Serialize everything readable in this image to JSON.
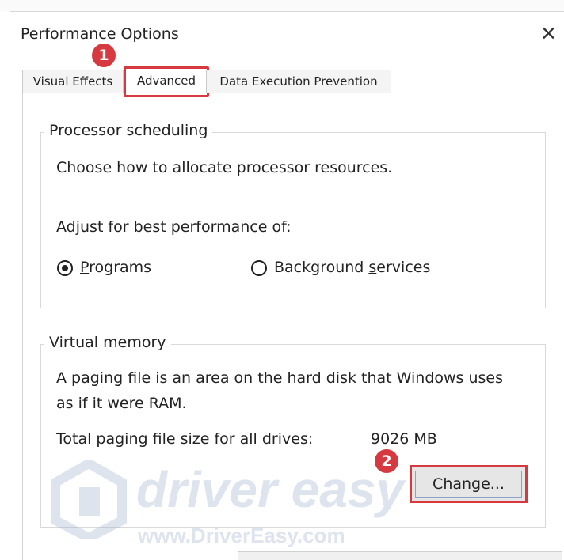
{
  "window": {
    "title": "Performance Options",
    "close_glyph": "✕"
  },
  "tabs": [
    {
      "label": "Visual Effects"
    },
    {
      "label": "Advanced",
      "selected": true
    },
    {
      "label": "Data Execution Prevention"
    }
  ],
  "processor": {
    "legend": "Processor scheduling",
    "description": "Choose how to allocate processor resources.",
    "adjust_label": "Adjust for best performance of:",
    "option_programs": {
      "mnemonic": "P",
      "rest": "rograms",
      "checked": true
    },
    "option_background": {
      "prefix": "Background ",
      "mnemonic": "s",
      "rest": "ervices",
      "checked": false
    }
  },
  "virtual_memory": {
    "legend": "Virtual memory",
    "description_line1": "A paging file is an area on the hard disk that Windows uses",
    "description_line2": "as if it were RAM.",
    "total_label": "Total paging file size for all drives:",
    "total_value": "9026 MB",
    "change_button": {
      "mnemonic": "C",
      "rest": "hange..."
    }
  },
  "annotations": {
    "step1": "1",
    "step2": "2",
    "accent": "#d63a40"
  },
  "watermark": {
    "brand": "driver easy",
    "url": "www.DriverEasy.com"
  }
}
